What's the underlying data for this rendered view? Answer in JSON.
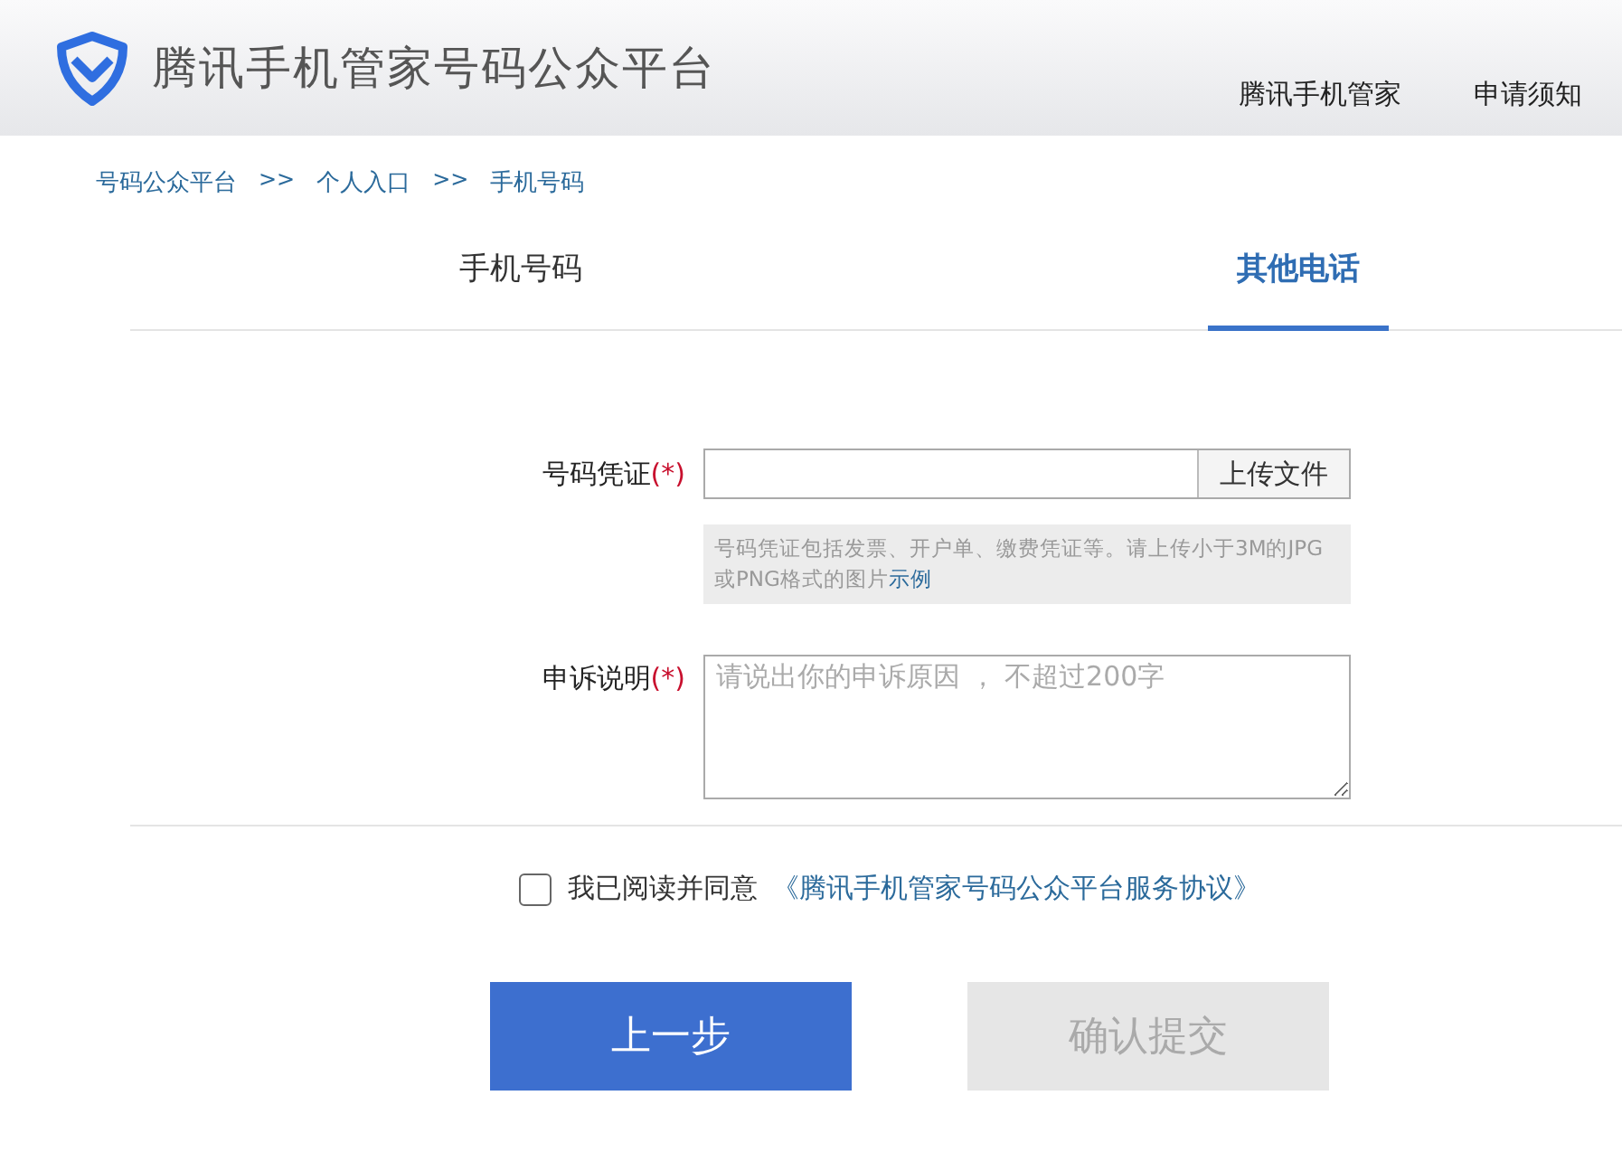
{
  "header": {
    "title": "腾讯手机管家号码公众平台",
    "nav": [
      {
        "label": "腾讯手机管家"
      },
      {
        "label": "申请须知"
      }
    ]
  },
  "breadcrumb": [
    {
      "label": "号码公众平台"
    },
    {
      "label": ">>",
      "kind": "separator"
    },
    {
      "label": "个人入口"
    },
    {
      "label": ">>",
      "kind": "separator"
    },
    {
      "label": "手机号码"
    }
  ],
  "tabs": [
    {
      "label": "手机号码",
      "selected": false
    },
    {
      "label": "其他电话",
      "selected": true
    }
  ],
  "form": {
    "proof": {
      "label": "号码凭证",
      "required_mark": "(*)",
      "upload_button": "上传文件",
      "hint": "号码凭证包括发票、开户单、缴费凭证等。请上传小于3M的JPG或PNG格式的图片",
      "hint_link": "示例"
    },
    "reason": {
      "label": "申诉说明",
      "required_mark": "(*)",
      "placeholder": "请说出你的申诉原因 ， 不超过200字"
    }
  },
  "agreement": {
    "checked": false,
    "text": "我已阅读并同意",
    "link": "《腾讯手机管家号码公众平台服务协议》"
  },
  "buttons": [
    {
      "label": "上一步",
      "disabled": false
    },
    {
      "label": "确认提交",
      "disabled": true
    }
  ]
}
